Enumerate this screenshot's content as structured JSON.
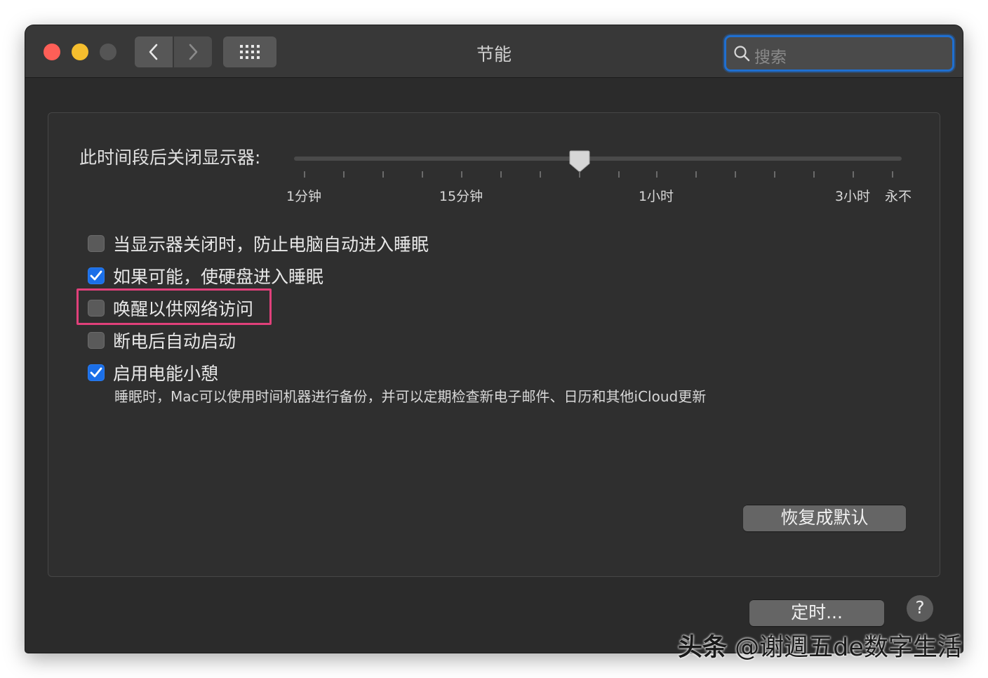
{
  "window": {
    "title": "节能"
  },
  "toolbar": {
    "search_placeholder": "搜索"
  },
  "display_sleep": {
    "label": "此时间段后关闭显示器:",
    "tick_labels": [
      "1分钟",
      "15分钟",
      "1小时",
      "3小时",
      "永不"
    ],
    "slider_value_fraction": 0.47
  },
  "options": [
    {
      "label": "当显示器关闭时，防止电脑自动进入睡眠",
      "checked": false
    },
    {
      "label": "如果可能，使硬盘进入睡眠",
      "checked": true
    },
    {
      "label": "唤醒以供网络访问",
      "checked": false
    },
    {
      "label": "断电后自动启动",
      "checked": false
    },
    {
      "label": "启用电能小憩",
      "checked": true
    }
  ],
  "power_nap_note": "睡眠时，Mac可以使用时间机器进行备份，并可以定期检查新电子邮件、日历和其他iCloud更新",
  "buttons": {
    "restore_defaults": "恢复成默认",
    "schedule": "定时...",
    "help": "?"
  },
  "watermark": {
    "brand": "头条",
    "handle": "@谢週五de数字生活"
  },
  "colors": {
    "accent": "#1b6fe8",
    "highlight": "#e0407a"
  }
}
